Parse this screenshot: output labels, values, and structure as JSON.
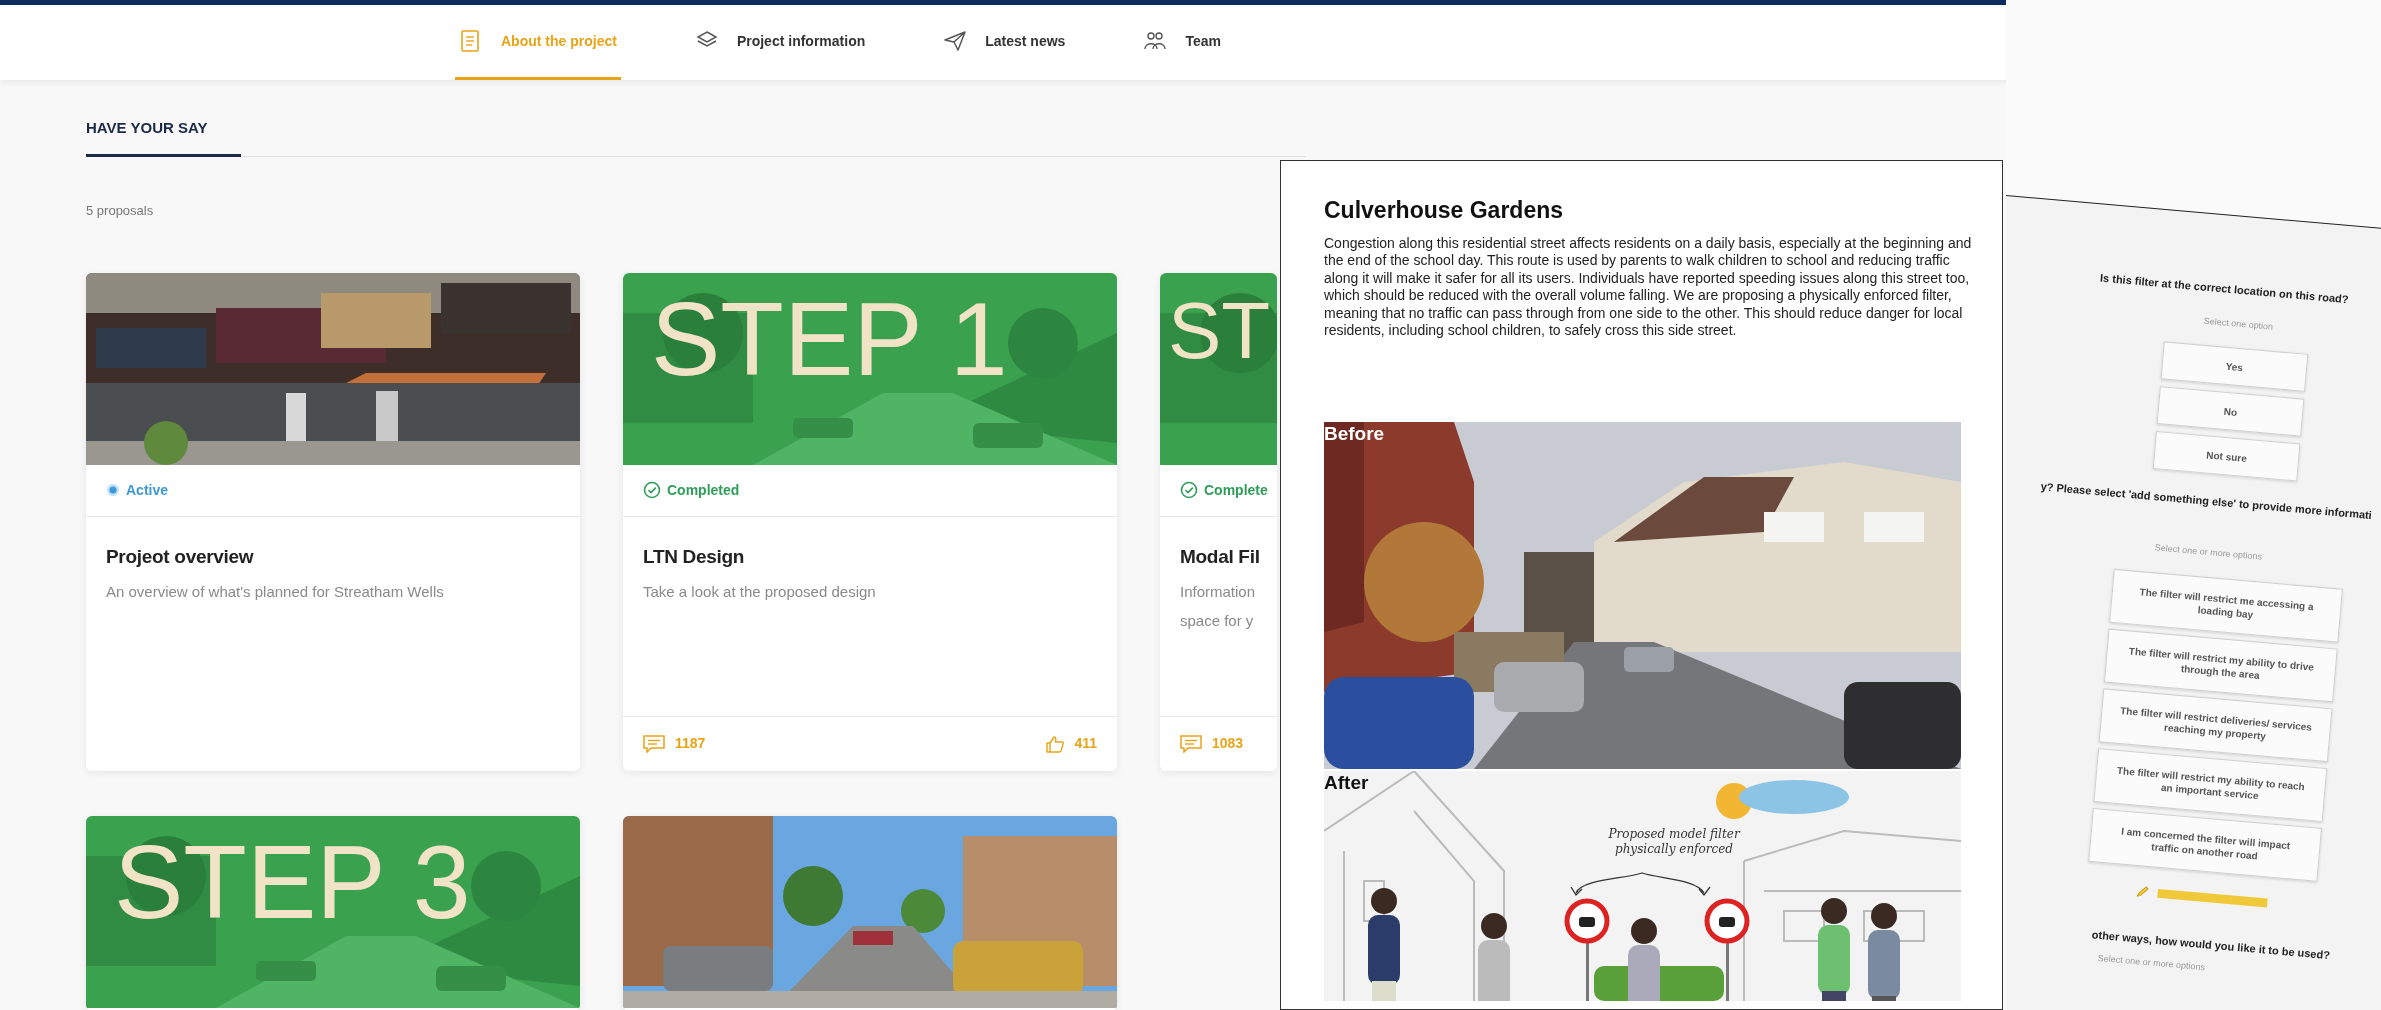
{
  "nav": {
    "tabs": [
      {
        "label": "About the project",
        "selected": true
      },
      {
        "label": "Project information",
        "selected": false
      },
      {
        "label": "Latest news",
        "selected": false
      },
      {
        "label": "Team",
        "selected": false
      }
    ]
  },
  "section": {
    "title": "HAVE YOUR SAY",
    "count": "5 proposals"
  },
  "proposals": [
    {
      "status": {
        "kind": "active",
        "label": "Active"
      },
      "title": "Projeot overview",
      "description_lines": [
        "An overview of what's planned for Streatham Wells"
      ]
    },
    {
      "image_text": "STEP 1",
      "status": {
        "kind": "completed",
        "label": "Completed"
      },
      "title": "LTN Design",
      "description_lines": [
        "Take a look at the proposed design"
      ],
      "stats": {
        "comments": "1187",
        "likes": "411"
      }
    },
    {
      "image_text": "ST",
      "status": {
        "kind": "completed",
        "label": "Complete"
      },
      "title": "Modal Fil",
      "description_lines": [
        "Information",
        "space for y"
      ],
      "stats": {
        "comments": "1083"
      }
    },
    {
      "image_text": "STEP 3"
    },
    {
      "kind": "picture"
    }
  ],
  "document": {
    "title": "Culverhouse Gardens",
    "body": "Congestion along this residential street affects residents on a daily basis, especially at the beginning and the end of the school day. This route is used by parents to walk children to school and reducing traffic along it will make it safer for all its users. Individuals have reported speeding issues along this street too, which should be reduced with the overall volume falling. We are proposing a physically enforced filter, meaning that no traffic can pass through from one side to the other. This should reduce danger for local residents, including school children, to safely cross this side street.",
    "figures": [
      {
        "label": "Before"
      },
      {
        "label": "After",
        "annotation": "Proposed model filter physically enforced"
      }
    ]
  },
  "survey": {
    "questions": [
      {
        "text": "Is this filter at the correct location on this road?",
        "hint": "Select one option",
        "options": [
          "Yes",
          "No",
          "Not sure"
        ]
      },
      {
        "text": "y? Please select 'add something else' to provide more informati",
        "hint": "Select one or more options",
        "options": [
          "The filter will restrict me accessing a loading bay",
          "The filter will restrict my ability to drive through the area",
          "The filter will restrict deliveries/ services reaching my property",
          "The filter will restrict my ability to reach an important service",
          "I am concerned the filter will impact traffic on another road"
        ],
        "add_link": true
      },
      {
        "text": "other ways, how would you like it to be used?",
        "hint": "Select one or more options"
      }
    ]
  }
}
